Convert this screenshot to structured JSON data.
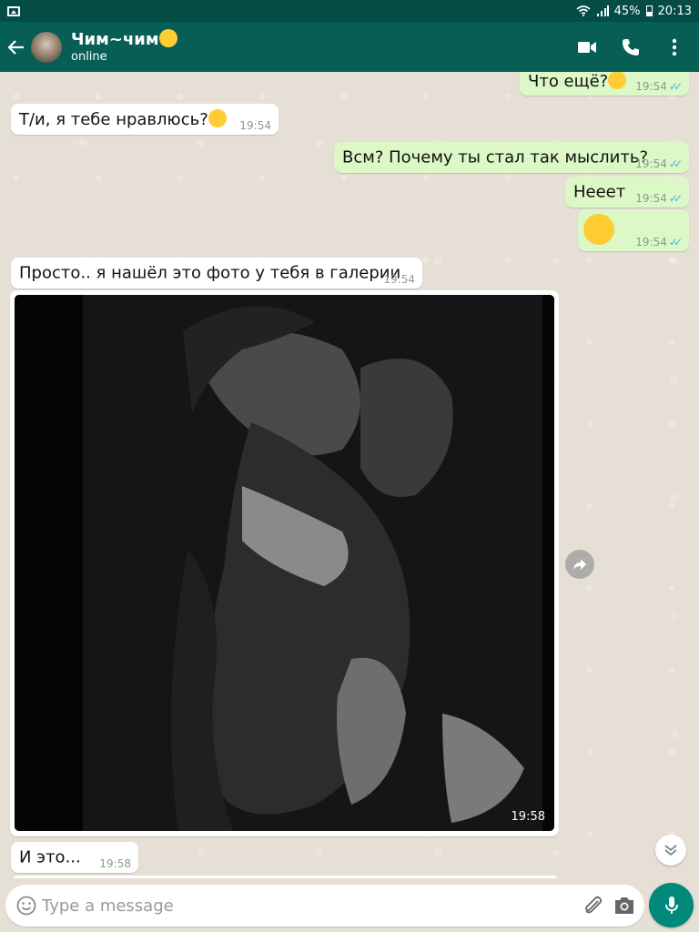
{
  "status_bar": {
    "battery": "45%",
    "time": "20:13",
    "icons": [
      "image-notification-icon",
      "wifi-icon",
      "signal-icon",
      "battery-icon"
    ]
  },
  "header": {
    "contact_name": "Чим~чим",
    "contact_emoji": "hugging-face-emoji",
    "status": "online",
    "actions": [
      "video-call-icon",
      "phone-icon",
      "more-vert-icon"
    ]
  },
  "messages": [
    {
      "dir": "out",
      "text": "Что ещё?",
      "emoji": "flushed-face-emoji",
      "time": "19:54",
      "read": true
    },
    {
      "dir": "in",
      "text": "Т/и, я тебе нравлюсь?",
      "emoji": "thinking-face-emoji",
      "time": "19:54"
    },
    {
      "dir": "out",
      "text": "Всм? Почему ты стал так мыслить?",
      "time": "19:54",
      "read": true
    },
    {
      "dir": "out",
      "text": "Нееет",
      "time": "19:54",
      "read": true
    },
    {
      "dir": "out",
      "text": "",
      "emoji": "zipper-mouth-face-emoji",
      "time": "19:54",
      "read": true
    },
    {
      "dir": "in",
      "text": "Просто.. я нашёл это фото у тебя в галерии",
      "time": "19:54"
    },
    {
      "dir": "in",
      "type": "photo",
      "description": "black-and-white photo",
      "time": "19:58"
    },
    {
      "dir": "in",
      "text": "И это...",
      "time": "19:58"
    }
  ],
  "input": {
    "placeholder": "Type a message"
  },
  "colors": {
    "header": "#075e54",
    "status_bar": "#054d44",
    "outgoing_bubble": "#dcf8c6",
    "incoming_bubble": "#ffffff",
    "read_ticks": "#34b7f1",
    "mic_button": "#00897b"
  }
}
